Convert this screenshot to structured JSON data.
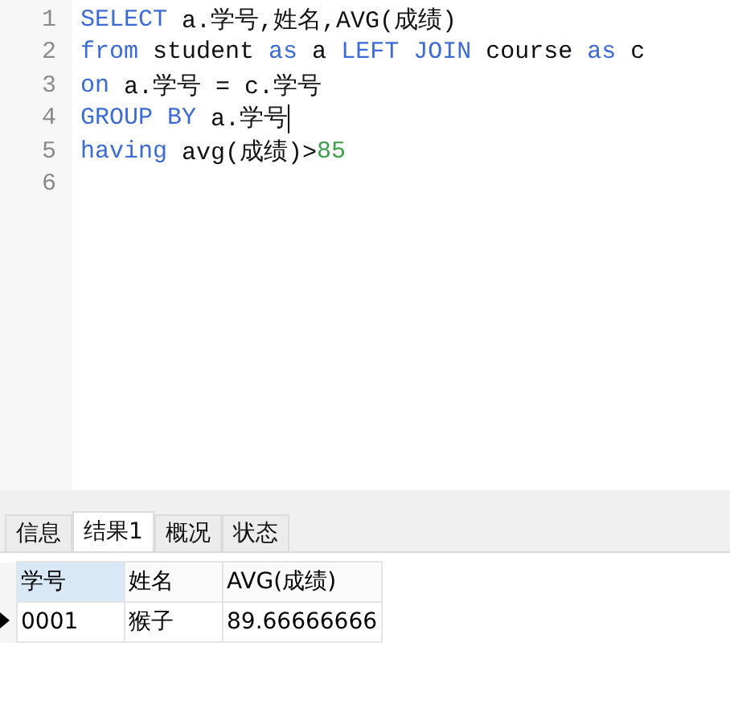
{
  "editor": {
    "lines": [
      {
        "number": "1",
        "cursor": false,
        "tokens": [
          {
            "kind": "keyword",
            "text": "SELECT"
          },
          {
            "kind": "plain",
            "text": " a.学号,姓名,AVG(成绩)"
          }
        ]
      },
      {
        "number": "2",
        "cursor": false,
        "tokens": [
          {
            "kind": "keyword",
            "text": "from"
          },
          {
            "kind": "plain",
            "text": " student "
          },
          {
            "kind": "keyword",
            "text": "as"
          },
          {
            "kind": "plain",
            "text": " a "
          },
          {
            "kind": "keyword",
            "text": "LEFT JOIN"
          },
          {
            "kind": "plain",
            "text": " course "
          },
          {
            "kind": "keyword",
            "text": "as"
          },
          {
            "kind": "plain",
            "text": " c"
          }
        ]
      },
      {
        "number": "3",
        "cursor": false,
        "tokens": [
          {
            "kind": "keyword",
            "text": "on"
          },
          {
            "kind": "plain",
            "text": " a.学号 = c.学号"
          }
        ]
      },
      {
        "number": "4",
        "cursor": true,
        "tokens": [
          {
            "kind": "keyword",
            "text": "GROUP BY"
          },
          {
            "kind": "plain",
            "text": " a.学号"
          }
        ]
      },
      {
        "number": "5",
        "cursor": false,
        "tokens": [
          {
            "kind": "keyword",
            "text": "having"
          },
          {
            "kind": "plain",
            "text": " avg(成绩)>"
          },
          {
            "kind": "number",
            "text": "85"
          }
        ]
      },
      {
        "number": "6",
        "cursor": false
      }
    ]
  },
  "tabs": [
    {
      "label": "信息",
      "selected": false
    },
    {
      "label": "结果1",
      "selected": true
    },
    {
      "label": "概况",
      "selected": false
    },
    {
      "label": "状态",
      "selected": false
    }
  ],
  "grid": {
    "columns": [
      {
        "label": "学号",
        "selected": true
      },
      {
        "label": "姓名",
        "selected": false
      },
      {
        "label": "AVG(成绩)",
        "selected": false
      }
    ],
    "rows": [
      {
        "current": true,
        "cells": [
          "0001",
          "猴子",
          "89.66666666"
        ]
      }
    ]
  }
}
